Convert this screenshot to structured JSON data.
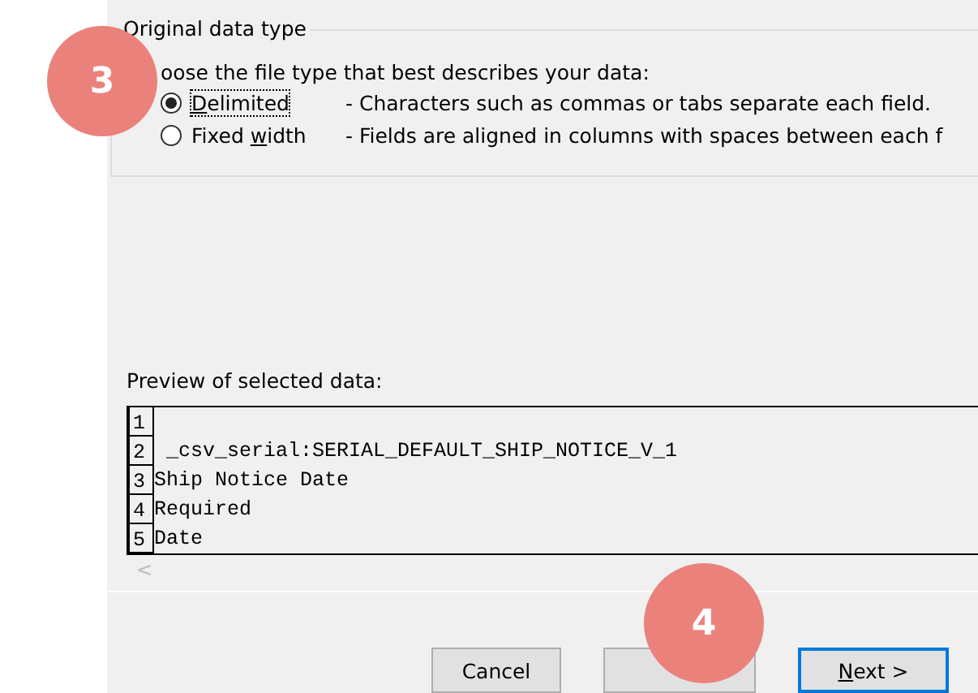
{
  "group_title": "Original data type",
  "prompt": "oose the file type that best describes your data:",
  "file_types": [
    {
      "access_key": "D",
      "label_after": "elimited",
      "description": "- Characters such as commas or tabs separate each field.",
      "selected": true
    },
    {
      "label_before": "Fixed ",
      "access_key": "w",
      "label_after": "idth",
      "description": "- Fields are aligned in columns with spaces between each f",
      "selected": false
    }
  ],
  "preview_label": "Preview of selected data:",
  "preview_rows": [
    {
      "number": "1"
    },
    {
      "number": "2",
      "text": " _csv_serial:SERIAL_DEFAULT_SHIP_NOTICE_V_1"
    },
    {
      "number": "3",
      "text": "Ship Notice Date"
    },
    {
      "number": "4",
      "text": "Required"
    },
    {
      "number": "5",
      "text": "Date"
    }
  ],
  "scroll_left": "<",
  "buttons": [
    {
      "kind": "plain",
      "label_before": "Cancel"
    },
    {
      "kind": "hidden"
    },
    {
      "kind": "default",
      "access_key": "N",
      "label_after": "ext >"
    }
  ],
  "badges": [
    {
      "kind": "top",
      "label": "3"
    },
    {
      "kind": "bottom",
      "label": "4"
    }
  ]
}
